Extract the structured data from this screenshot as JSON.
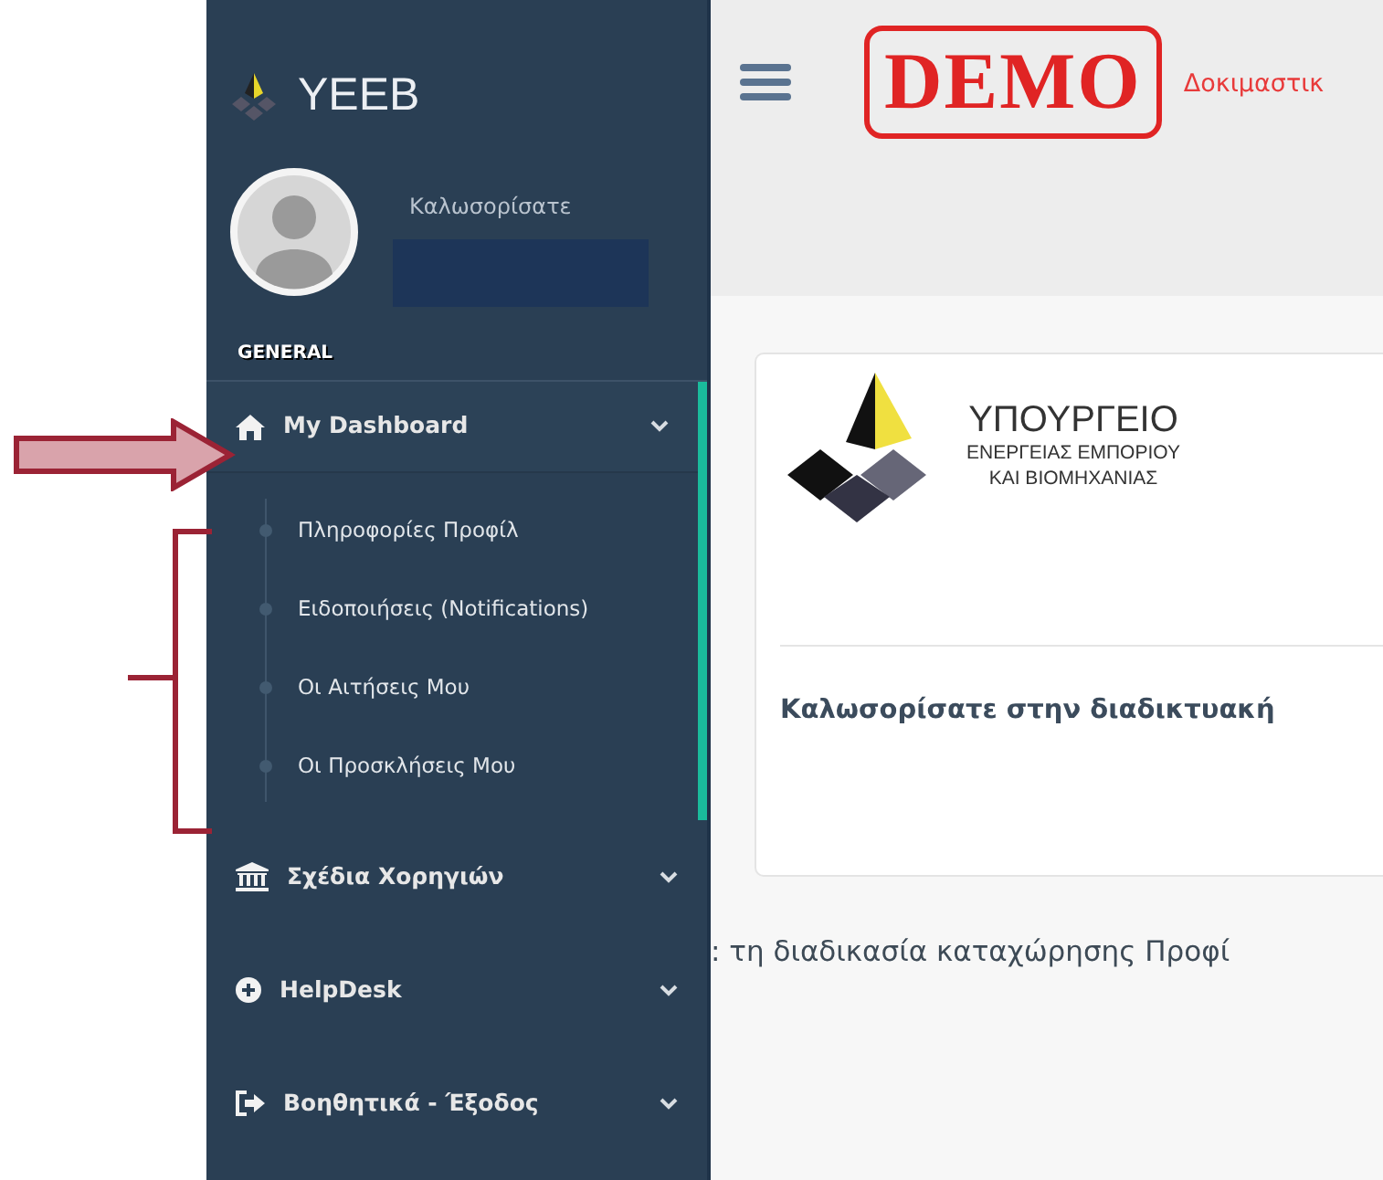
{
  "sidebar": {
    "brand": "YEEB",
    "welcome": "Καλωσορίσατε",
    "section_title": "GENERAL",
    "menu": [
      {
        "label": "My Dashboard",
        "expanded": true,
        "active": true,
        "children": [
          {
            "label": "Πληροφορίες Προφίλ"
          },
          {
            "label": "Ειδοποιήσεις (Notifications)"
          },
          {
            "label": "Οι Αιτήσεις Μου"
          },
          {
            "label": "Οι Προσκλήσεις Μου"
          }
        ]
      },
      {
        "label": "Σχέδια Χορηγιών",
        "expanded": false,
        "active": false
      },
      {
        "label": "HelpDesk",
        "expanded": false,
        "active": false
      },
      {
        "label": "Βοηθητικά - Έξοδος",
        "expanded": false,
        "active": false
      }
    ]
  },
  "topbar": {
    "stamp": "DEMO",
    "notice": "Δοκιμαστικ"
  },
  "card": {
    "logo_lines": [
      "ΥΠΟΥΡΓΕΙΟ",
      "ΕΝΕΡΓΕΙΑΣ ΕΜΠΟΡΙΟΥ",
      "ΚΑΙ ΒΙΟΜΗΧΑΝΙΑΣ"
    ],
    "welcome": "Καλωσορίσατε στην διαδικτυακή"
  },
  "footer_text": ": τη διαδικασία καταχώρησης Προφί"
}
